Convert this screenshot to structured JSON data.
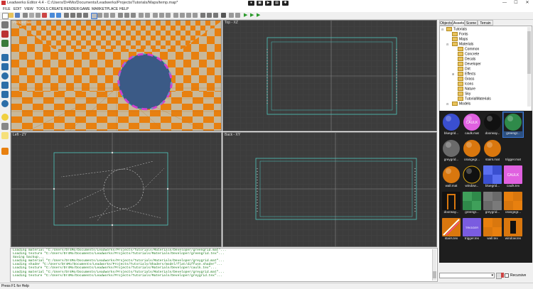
{
  "window": {
    "title": "Leadwerks Editor 4.4 - C:/Users/Dr4Mo/Documents/Leadwerks/Projects/Tutorials/Maps/temp.map*",
    "minimize": "—",
    "maximize": "☐",
    "close": "✕"
  },
  "menu": [
    "FILE",
    "EDIT",
    "VIEW",
    "TOOLS",
    "CREATE",
    "RENDER",
    "GAME",
    "MARKETPLACE",
    "HELP"
  ],
  "viewports": {
    "perspective": "Perspective",
    "top": "Top - XZ",
    "left": "Left - ZY",
    "back": "Back - XY"
  },
  "console": {
    "lines": [
      "Loading material \"C:/Users/Dr4Mo/Documents/Leadworks/Projects/Tutorials/Materials/Developer/greengrid.mat\"...",
      "Loading texture \"C:/Users/Dr4Mo/Documents/Leadworks/Projects/Tutorials/Materials/Developer/greengrid.tex\"...",
      "Saving backup...",
      "Loading material \"C:/Users/Dr4Mo/Documents/Leadworks/Projects/Tutorials/Materials/Developer/greygrid.mat\"...",
      "Loading shader \"C:/Users/Dr4Mo/Documents/Leadworks/Projects/Tutorials/Shaders/model/flat/diffuse.shader\"...",
      "Loading texture \"C:/Users/Dr4Mo/Documents/Leadworks/Projects/Tutorials/Materials/Developer/caulk.tex\"...",
      "Loading material \"C:/Users/Dr4Mo/Documents/Leadworks/Projects/Tutorials/Materials/Developer/greygrid.mat\"...",
      "Loading texture \"C:/Users/Dr4Mo/Documents/Leadworks/Projects/Tutorials/Materials/Developer/greygrid.tex\"..."
    ]
  },
  "status": "Press F1 for Help",
  "panel": {
    "tabs": [
      "Objects",
      "Assets",
      "Scene",
      "Terrain"
    ],
    "active_tab": "Assets",
    "tree": [
      {
        "label": "Tutorials",
        "depth": 0,
        "twisty": "⊟"
      },
      {
        "label": "Fonts",
        "depth": 1,
        "twisty": ""
      },
      {
        "label": "Maps",
        "depth": 1,
        "twisty": ""
      },
      {
        "label": "Materials",
        "depth": 1,
        "twisty": "⊟"
      },
      {
        "label": "Common",
        "depth": 2,
        "twisty": ""
      },
      {
        "label": "Concrete",
        "depth": 2,
        "twisty": ""
      },
      {
        "label": "Decals",
        "depth": 2,
        "twisty": ""
      },
      {
        "label": "Developer",
        "depth": 2,
        "twisty": ""
      },
      {
        "label": "Dirt",
        "depth": 2,
        "twisty": ""
      },
      {
        "label": "Effects",
        "depth": 2,
        "twisty": "⊞"
      },
      {
        "label": "Grass",
        "depth": 2,
        "twisty": ""
      },
      {
        "label": "Icons",
        "depth": 2,
        "twisty": ""
      },
      {
        "label": "Nature",
        "depth": 2,
        "twisty": ""
      },
      {
        "label": "Sky",
        "depth": 2,
        "twisty": ""
      },
      {
        "label": "TutorialMaterials",
        "depth": 2,
        "twisty": ""
      },
      {
        "label": "Models",
        "depth": 1,
        "twisty": "⊟"
      }
    ],
    "assets": [
      {
        "label": "bluegrid...",
        "kind": "ball-blue"
      },
      {
        "label": "caulk.mat",
        "kind": "ball-caulk",
        "caulk_text": "CAULK"
      },
      {
        "label": "doorway...",
        "kind": "ball-black"
      },
      {
        "label": "greengr...",
        "kind": "ball-green",
        "selected": true
      },
      {
        "label": "greygrid...",
        "kind": "ball-grey"
      },
      {
        "label": "orangegr...",
        "kind": "ball-orange"
      },
      {
        "label": "stairs.mat",
        "kind": "ball-orange"
      },
      {
        "label": "trigger.mat",
        "kind": "dark"
      },
      {
        "label": "wall.mat",
        "kind": "ball-orange"
      },
      {
        "label": "window...",
        "kind": "ball-black-rim"
      },
      {
        "label": "bluegrid...",
        "kind": "tex-blue"
      },
      {
        "label": "caulk.tex",
        "kind": "tex-caulk",
        "caulk_text": "CAULK"
      },
      {
        "label": "doorway...",
        "kind": "tex-doorway"
      },
      {
        "label": "greengr...",
        "kind": "tex-green"
      },
      {
        "label": "greygrid...",
        "kind": "tex-grey"
      },
      {
        "label": "orangegr...",
        "kind": "tex-orange"
      },
      {
        "label": "stairs.tex",
        "kind": "tex-stairs"
      },
      {
        "label": "trigger.tex",
        "kind": "tex-trigger",
        "trigger_text": "TRIGGER"
      },
      {
        "label": "wall.tex",
        "kind": "tex-orange"
      },
      {
        "label": "window.tex",
        "kind": "tex-window"
      }
    ],
    "recursive_label": "Recursive"
  },
  "colors": {
    "orange": "#e8800f",
    "grid_line": "#4fc7c0",
    "selection": "#3b78d8"
  }
}
